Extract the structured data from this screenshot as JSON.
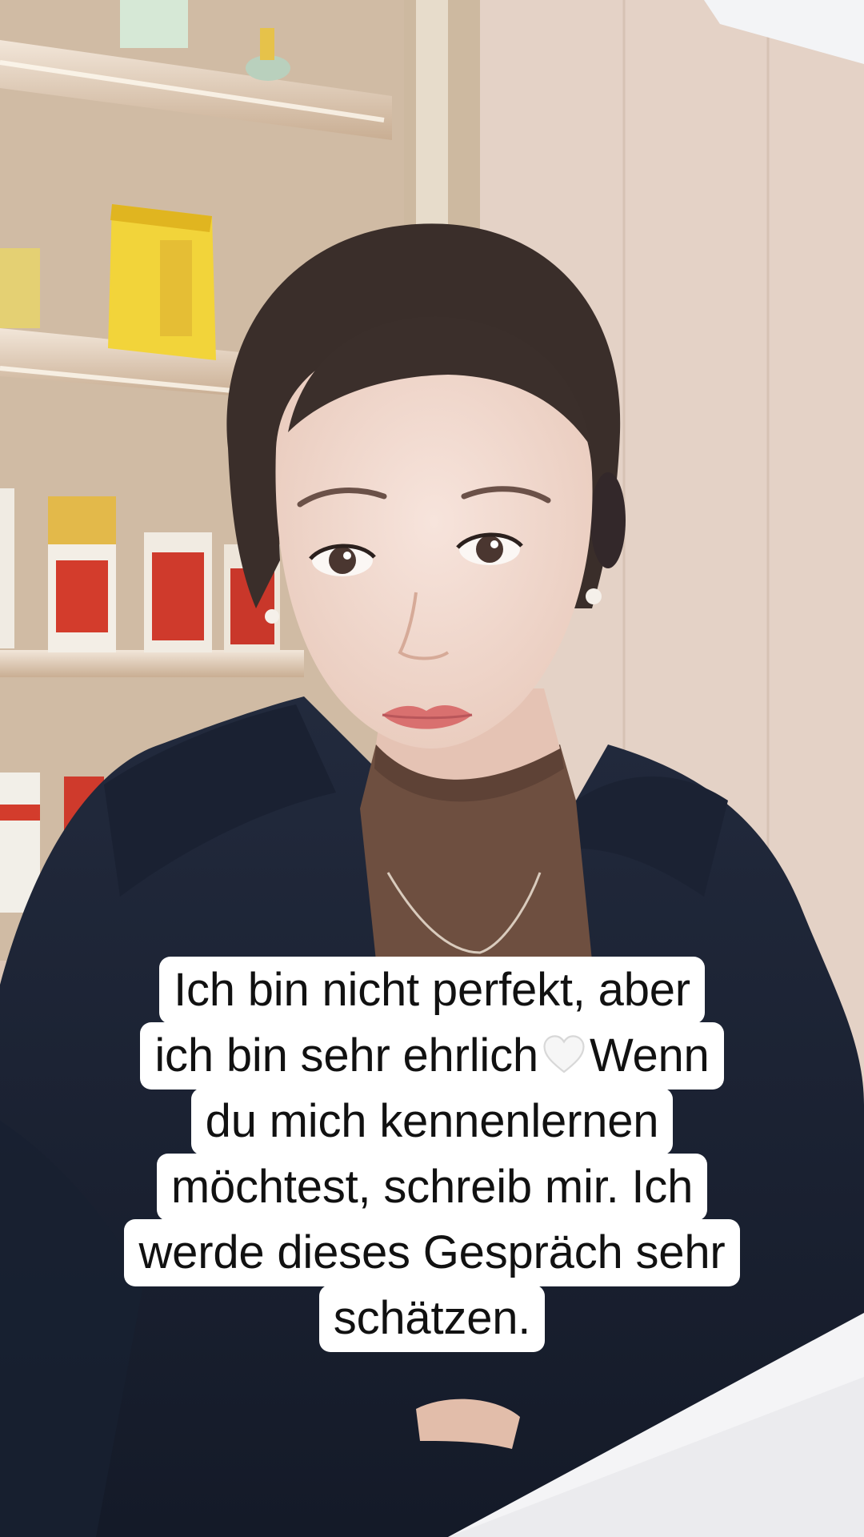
{
  "caption": {
    "lines": [
      "Ich bin nicht perfekt, aber",
      "ich bin sehr ehrlich",
      "Wenn",
      "du mich kennenlernen",
      "möchtest, schreib mir. Ich",
      "werde dieses Gespräch sehr",
      "schätzen."
    ],
    "emoji": "white-heart-icon"
  },
  "scene": {
    "subject": "woman-in-dark-coat-and-brown-turtleneck",
    "background": "shelves-with-boxed-products",
    "colors": {
      "wall": "#e3d0c3",
      "shelf": "#d8c2aa",
      "coat": "#1c2233",
      "turtleneck": "#6e4f40",
      "skin": "#f0d9cf",
      "hair": "#3a2e2a",
      "table": "#f4f4f6"
    }
  }
}
